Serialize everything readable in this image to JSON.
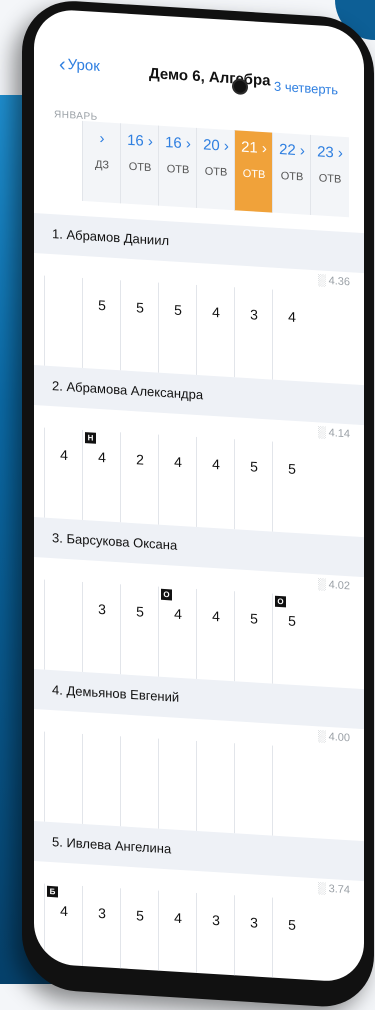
{
  "header": {
    "back_label": "Урок",
    "title": "Демо 6, Алгебра",
    "quarter": "3 четверть",
    "month": "ЯНВАРЬ"
  },
  "dates": [
    {
      "day": "",
      "type": "ДЗ",
      "active": false
    },
    {
      "day": "16 ›",
      "type": "ОТВ",
      "active": false
    },
    {
      "day": "16 ›",
      "type": "ОТВ",
      "active": false
    },
    {
      "day": "20 ›",
      "type": "ОТВ",
      "active": false
    },
    {
      "day": "21 ›",
      "type": "ОТВ",
      "active": true
    },
    {
      "day": "22 ›",
      "type": "ОТВ",
      "active": false
    },
    {
      "day": "23 ›",
      "type": "ОТВ",
      "active": false
    }
  ],
  "students": [
    {
      "name": "1. Абрамов Даниил",
      "avg": "4.36",
      "marks": [
        "",
        "5",
        "5",
        "5",
        "4",
        "3",
        "4"
      ],
      "tags": [
        "",
        "",
        "",
        "",
        "",
        "",
        ""
      ]
    },
    {
      "name": "2. Абрамова Александра",
      "avg": "4.14",
      "marks": [
        "4",
        "4",
        "2",
        "4",
        "4",
        "5",
        "5"
      ],
      "tags": [
        "",
        "Н",
        "",
        "",
        "",
        "",
        ""
      ]
    },
    {
      "name": "3. Барсукова Оксана",
      "avg": "4.02",
      "marks": [
        "",
        "3",
        "5",
        "4",
        "4",
        "5",
        "5"
      ],
      "tags": [
        "",
        "",
        "",
        "О",
        "",
        "",
        "О"
      ]
    },
    {
      "name": "4. Демьянов Евгений",
      "avg": "4.00",
      "marks": [
        "",
        "",
        "",
        "",
        "",
        "",
        ""
      ],
      "tags": [
        "",
        "",
        "",
        "",
        "",
        "",
        ""
      ]
    },
    {
      "name": "5. Ивлева Ангелина",
      "avg": "3.74",
      "marks": [
        "4",
        "3",
        "5",
        "4",
        "3",
        "3",
        "5"
      ],
      "tags": [
        "Б",
        "",
        "",
        "",
        "",
        "",
        ""
      ]
    }
  ],
  "colors": {
    "accent": "#f0a23a",
    "link": "#2f7fe0"
  }
}
